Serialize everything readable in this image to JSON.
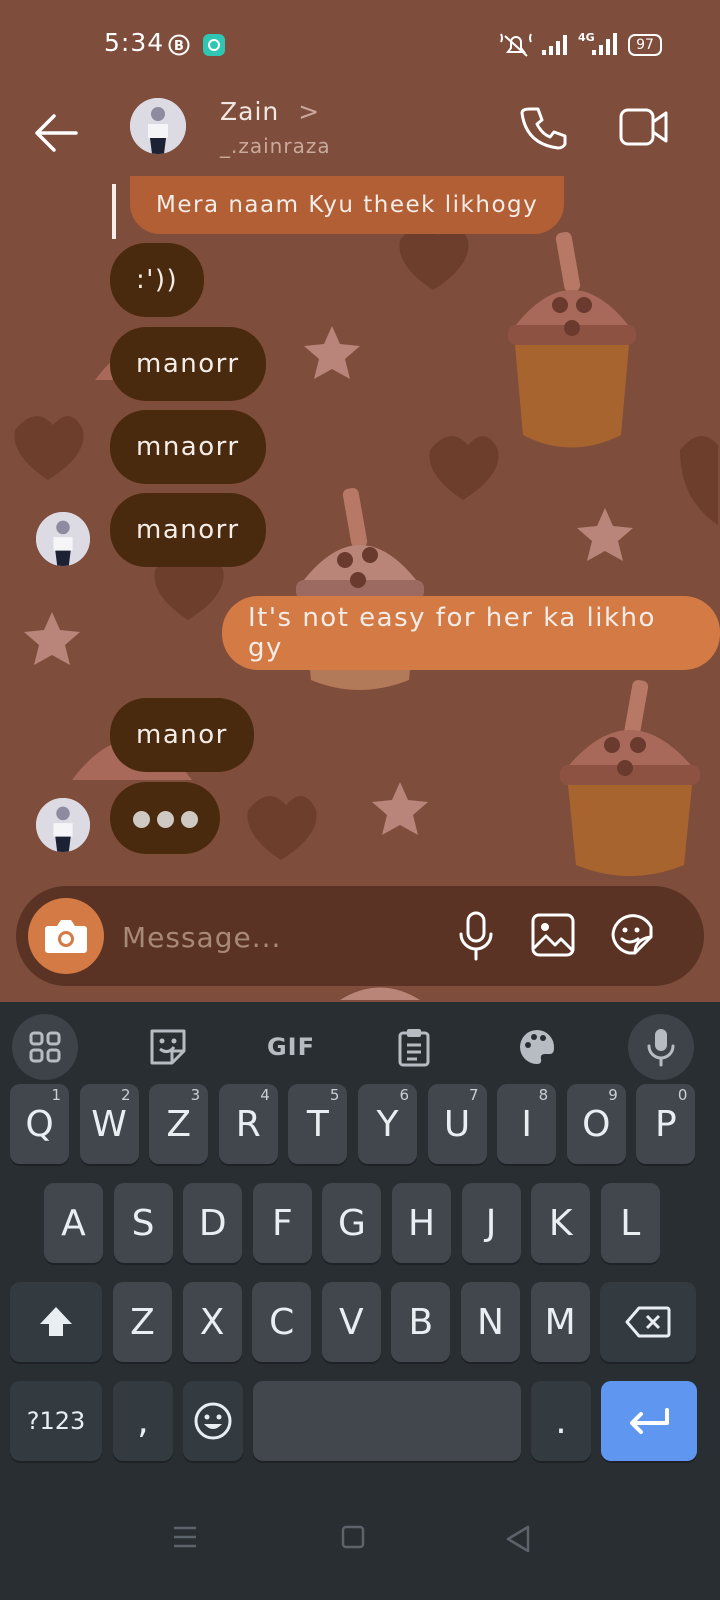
{
  "status_bar": {
    "time": "5:34",
    "battery": "97",
    "network": "4G",
    "icons": [
      "b-circle-icon",
      "chat-app-icon",
      "mute-icon",
      "signal-icon",
      "signal-4g-icon",
      "battery-icon"
    ]
  },
  "header": {
    "name": "Zain",
    "chevron": ">",
    "username": "_.zainraza",
    "icons": [
      "back-arrow-icon",
      "phone-icon",
      "video-icon"
    ]
  },
  "messages": [
    {
      "id": "m0",
      "side": "out",
      "text": "Mera naam Kyu theek likhogy",
      "style": "reply"
    },
    {
      "id": "m1",
      "side": "in",
      "text": ":'))"
    },
    {
      "id": "m2",
      "side": "in",
      "text": "manorr"
    },
    {
      "id": "m3",
      "side": "in",
      "text": "mnaorr"
    },
    {
      "id": "m4",
      "side": "in",
      "text": "manorr"
    },
    {
      "id": "m5",
      "side": "out",
      "text": "It's not easy for her ka likho gy"
    },
    {
      "id": "m6",
      "side": "in",
      "text": "manor"
    },
    {
      "id": "m7",
      "side": "in",
      "text": "",
      "typing": true
    }
  ],
  "composer": {
    "placeholder": "Message...",
    "value": "",
    "icons": [
      "camera-icon",
      "mic-icon",
      "image-icon",
      "sticker-icon"
    ]
  },
  "keyboard": {
    "toolbar": [
      "apps-grid-icon",
      "sticker-icon",
      "GIF",
      "clipboard-icon",
      "palette-icon",
      "mic-icon"
    ],
    "gif_label": "GIF",
    "row1": [
      {
        "k": "Q",
        "h": "1"
      },
      {
        "k": "W",
        "h": "2"
      },
      {
        "k": "Z",
        "h": "3"
      },
      {
        "k": "R",
        "h": "4"
      },
      {
        "k": "T",
        "h": "5"
      },
      {
        "k": "Y",
        "h": "6"
      },
      {
        "k": "U",
        "h": "7"
      },
      {
        "k": "I",
        "h": "8"
      },
      {
        "k": "O",
        "h": "9"
      },
      {
        "k": "P",
        "h": "0"
      }
    ],
    "row2": [
      "A",
      "S",
      "D",
      "F",
      "G",
      "H",
      "J",
      "K",
      "L"
    ],
    "row3": [
      "Z",
      "X",
      "C",
      "V",
      "B",
      "N",
      "M"
    ],
    "symbols_label": "?123",
    "comma": ",",
    "period": "."
  },
  "colors": {
    "wallpaper": "#7f4d3b",
    "incoming_bubble": "#4a2a0e",
    "outgoing_bubble": "#d47a45",
    "keyboard": "#292e33",
    "enter_key": "#5f96f0"
  }
}
